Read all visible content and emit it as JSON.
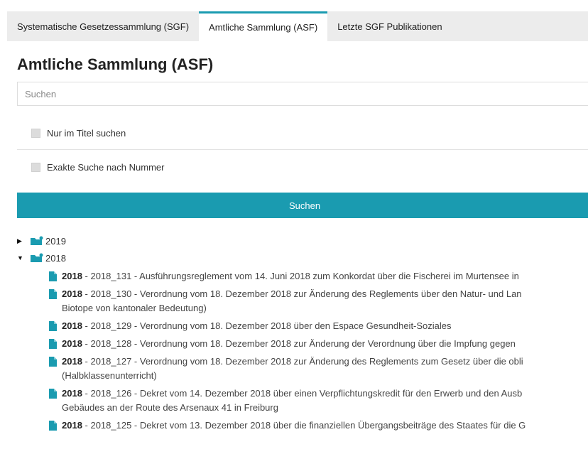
{
  "tabs": [
    {
      "label": "Systematische Gesetzessammlung (SGF)"
    },
    {
      "label": "Amtliche Sammlung (ASF)"
    },
    {
      "label": "Letzte SGF Publikationen"
    }
  ],
  "page_title": "Amtliche Sammlung (ASF)",
  "search": {
    "placeholder": "Suchen",
    "value": ""
  },
  "options": {
    "title_only": "Nur im Titel suchen",
    "exact_number": "Exakte Suche nach Nummer"
  },
  "search_button": "Suchen",
  "tree": {
    "years": [
      {
        "label": "2019",
        "expanded": false
      },
      {
        "label": "2018",
        "expanded": true
      }
    ],
    "documents": [
      {
        "year": "2018",
        "text": " - 2018_131 - Ausführungsreglement vom 14. Juni 2018 zum Konkordat über die Fischerei im Murtensee in",
        "second": ""
      },
      {
        "year": "2018",
        "text": " - 2018_130 - Verordnung vom 18. Dezember 2018 zur Änderung des Reglements über den Natur- und Lan",
        "second": "Biotope von kantonaler Bedeutung)"
      },
      {
        "year": "2018",
        "text": " - 2018_129 - Verordnung vom 18. Dezember 2018 über den Espace Gesundheit-Soziales",
        "second": ""
      },
      {
        "year": "2018",
        "text": " - 2018_128 - Verordnung vom 18. Dezember 2018 zur Änderung der Verordnung über die Impfung gegen",
        "second": ""
      },
      {
        "year": "2018",
        "text": " - 2018_127 - Verordnung vom 18. Dezember 2018 zur Änderung des Reglements zum Gesetz über die obli",
        "second": "(Halbklassenunterricht)"
      },
      {
        "year": "2018",
        "text": " - 2018_126 - Dekret vom 14. Dezember 2018 über einen Verpflichtungskredit für den Erwerb und den Ausb",
        "second": "Gebäudes an der Route des Arsenaux 41 in Freiburg"
      },
      {
        "year": "2018",
        "text": " - 2018_125 - Dekret vom 13. Dezember 2018 über die finanziellen Übergangsbeiträge des Staates für die G",
        "second": ""
      }
    ]
  },
  "colors": {
    "accent": "#1a9bb0",
    "tab_bar": "#ececec"
  }
}
